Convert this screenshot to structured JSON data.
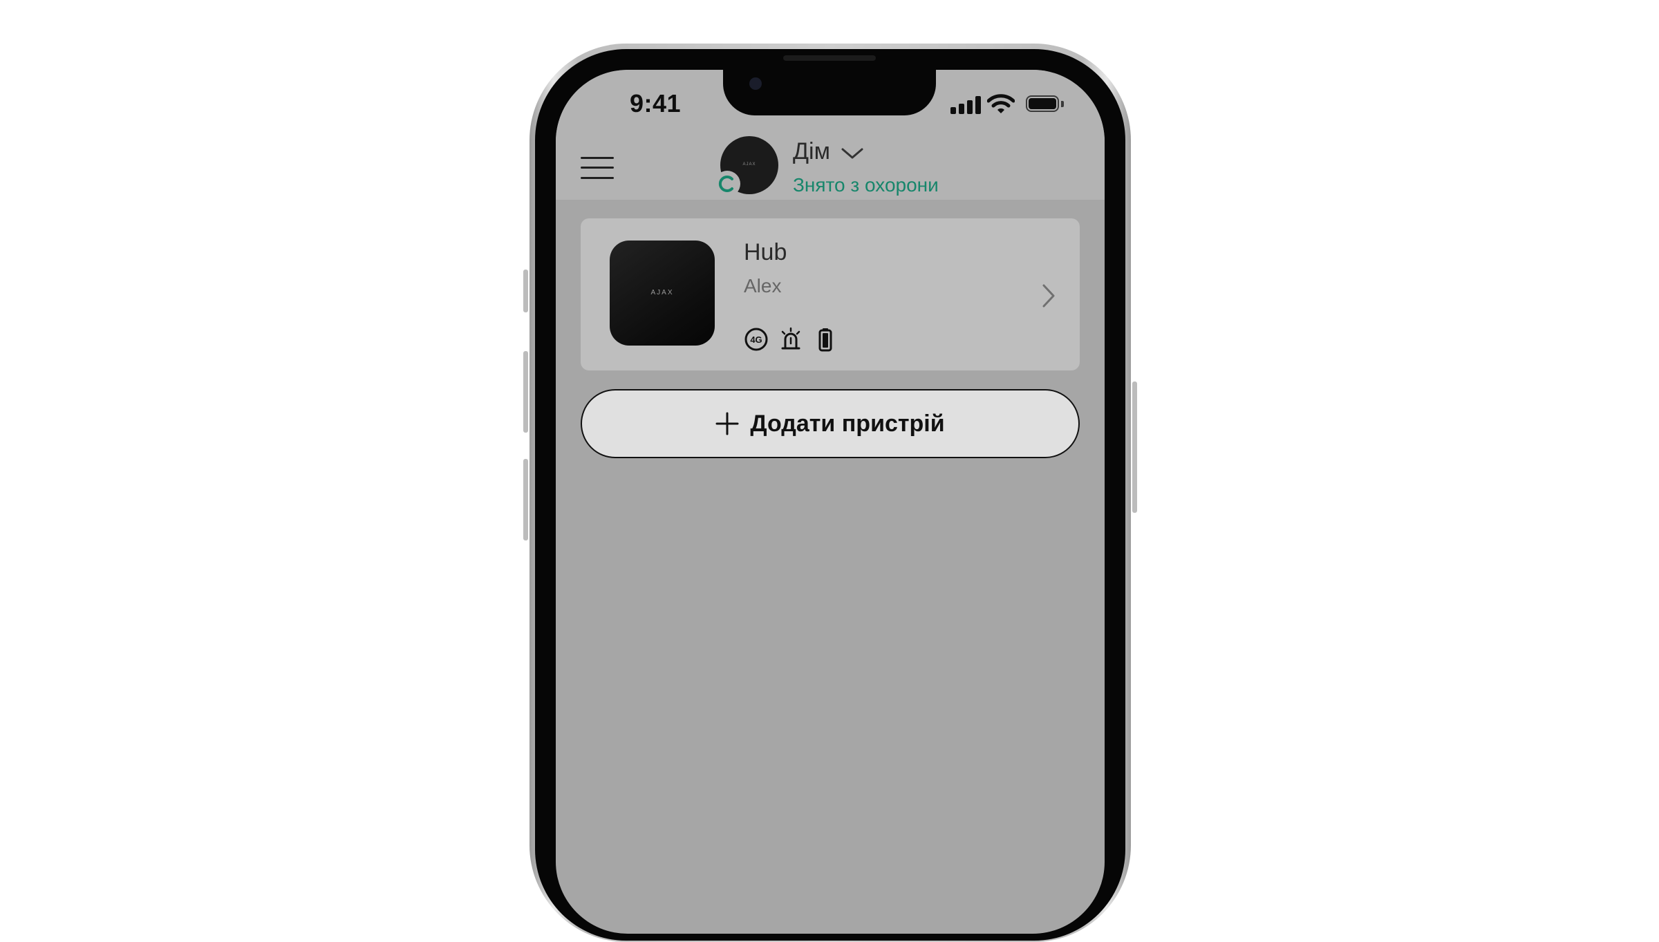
{
  "status_bar": {
    "time": "9:41",
    "icons": [
      "cellular-signal-icon",
      "wifi-icon",
      "battery-icon"
    ]
  },
  "header": {
    "menu_icon": "hamburger-menu-icon",
    "space": {
      "name": "Дім",
      "status": "Знято з охорони",
      "status_color": "#17866b",
      "avatar_logo": "AJAX"
    }
  },
  "devices": [
    {
      "name": "Hub",
      "owner": "Alex",
      "image_logo": "AJAX",
      "status_icons": [
        {
          "name": "4g-connection-icon",
          "label": "4G"
        },
        {
          "name": "siren-icon"
        },
        {
          "name": "battery-icon"
        }
      ]
    }
  ],
  "add_device": {
    "label": "Додати пристрій",
    "icon": "plus-icon"
  },
  "colors": {
    "screen_background": "#a6a6a6",
    "header_background": "#b3b3b3",
    "card_background": "#bebebe",
    "button_background": "#e0e0e0",
    "accent_green": "#17866b"
  }
}
